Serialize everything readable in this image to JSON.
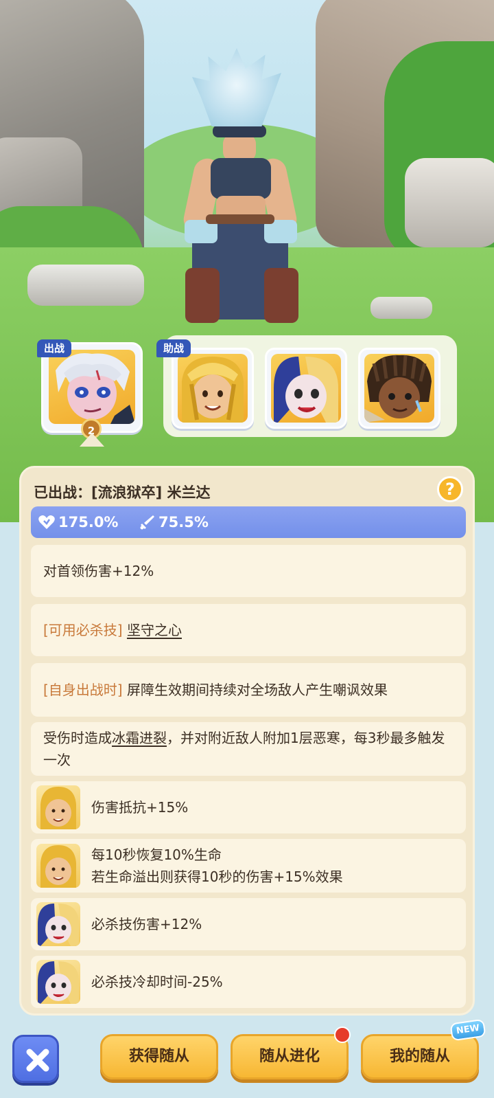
{
  "team": {
    "main_tag": "出战",
    "support_tag": "助战",
    "main_level": "2"
  },
  "info": {
    "header_prefix": "已出战：",
    "header_name": "[流浪狱卒] 米兰达",
    "stats": [
      {
        "icon": "heart-icon",
        "value": "175.0%"
      },
      {
        "icon": "sword-icon",
        "value": "75.5%"
      }
    ],
    "rows": [
      {
        "text": "对首领伤害+12%"
      },
      {
        "tag": "[可用必杀技]",
        "link": "坚守之心"
      },
      {
        "tag": "[自身出战时]",
        "text": "屏障生效期间持续对全场敌人产生嘲讽效果"
      },
      {
        "pre": "受伤时造成",
        "link": "冰霜进裂",
        "post": "，并对附近敌人附加1层恶寒，每3秒最多触发一次"
      },
      {
        "icon": "gold-helmet-companion-icon",
        "text": "伤害抵抗+15%"
      },
      {
        "icon": "gold-helmet-companion-icon",
        "line1": "每10秒恢复10%生命",
        "line2": "若生命溢出则获得10秒的伤害+15%效果"
      },
      {
        "icon": "harlequin-companion-icon",
        "text": "必杀技伤害+12%"
      },
      {
        "icon": "harlequin-companion-icon",
        "text": "必杀技冷却时间-25%"
      }
    ]
  },
  "bottom": {
    "get_label": "获得随从",
    "evolve_label": "随从进化",
    "mine_label": "我的随从",
    "new_badge": "NEW"
  },
  "colors": {
    "accent_blue": "#3457b8",
    "stat_bar": "#7b97ec",
    "highlight": "#c8793a",
    "button_gold": "#f7b733"
  }
}
